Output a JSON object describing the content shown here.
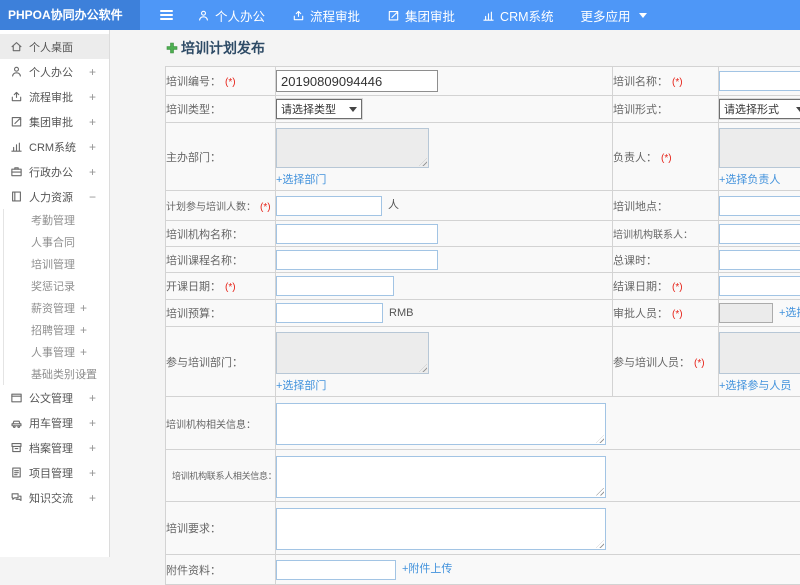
{
  "topbar": {
    "logo": "PHPOA协同办公软件",
    "menu_icon": "hamburger-icon",
    "nav": [
      {
        "label": "个人办公",
        "icon": "user-icon"
      },
      {
        "label": "流程审批",
        "icon": "flow-icon"
      },
      {
        "label": "集团审批",
        "icon": "edit-icon"
      },
      {
        "label": "CRM系统",
        "icon": "chart-icon"
      },
      {
        "label": "更多应用",
        "icon": "caret-down-icon",
        "dropdown": true
      }
    ]
  },
  "sidebar": {
    "items": [
      {
        "label": "个人桌面",
        "icon": "home-icon",
        "active": true
      },
      {
        "label": "个人办公",
        "icon": "user-icon",
        "expand": "+"
      },
      {
        "label": "流程审批",
        "icon": "flow-icon",
        "expand": "+"
      },
      {
        "label": "集团审批",
        "icon": "edit-icon",
        "expand": "+"
      },
      {
        "label": "CRM系统",
        "icon": "chart-icon",
        "expand": "+"
      },
      {
        "label": "行政办公",
        "icon": "briefcase-icon",
        "expand": "+"
      },
      {
        "label": "人力资源",
        "icon": "hr-icon",
        "expand": "−"
      },
      {
        "label": "考勤管理",
        "sub": true
      },
      {
        "label": "人事合同",
        "sub": true
      },
      {
        "label": "培训管理",
        "sub": true
      },
      {
        "label": "奖惩记录",
        "sub": true
      },
      {
        "label": "薪资管理",
        "sub": true,
        "expand": "+"
      },
      {
        "label": "招聘管理",
        "sub": true,
        "expand": "+"
      },
      {
        "label": "人事管理",
        "sub": true,
        "expand": "+"
      },
      {
        "label": "基础类别设置",
        "sub": true,
        "expand": "+"
      },
      {
        "label": "公文管理",
        "icon": "doc-icon",
        "expand": "+"
      },
      {
        "label": "用车管理",
        "icon": "car-icon",
        "expand": "+"
      },
      {
        "label": "档案管理",
        "icon": "archive-icon",
        "expand": "+"
      },
      {
        "label": "项目管理",
        "icon": "project-icon",
        "expand": "+"
      },
      {
        "label": "知识交流",
        "icon": "chat-icon",
        "expand": "+"
      }
    ]
  },
  "form": {
    "title": "培训计划发布",
    "title_icon": "plus-icon",
    "required_mark": "(*)",
    "pairs": [
      {
        "left": {
          "name": "training-number",
          "label": "培训编号：",
          "required": true,
          "value": "20190809094446"
        },
        "right": {
          "name": "training-name",
          "label": "培训名称：",
          "required": true
        }
      },
      {
        "left": {
          "name": "training-type",
          "label": "培训类型：",
          "value": "请选择类型"
        },
        "right": {
          "name": "training-form",
          "label": "培训形式：",
          "value": "请选择形式"
        }
      },
      {
        "left": {
          "name": "host-department",
          "label": "主办部门：",
          "link": "+选择部门"
        },
        "right": {
          "name": "person-in-charge",
          "label": "负责人：",
          "required": true,
          "link": "+选择负责人"
        }
      },
      {
        "left": {
          "name": "planned-participants",
          "label": "计划参与培训人数：",
          "required": true,
          "suffix": "人"
        },
        "right": {
          "name": "training-location",
          "label": "培训地点："
        }
      },
      {
        "left": {
          "name": "training-org-name",
          "label": "培训机构名称："
        },
        "right": {
          "name": "training-org-contact",
          "label": "培训机构联系人："
        }
      },
      {
        "left": {
          "name": "training-course-name",
          "label": "培训课程名称："
        },
        "right": {
          "name": "total-hours",
          "label": "总课时："
        }
      },
      {
        "left": {
          "name": "start-date",
          "label": "开课日期：",
          "required": true
        },
        "right": {
          "name": "end-date",
          "label": "结课日期：",
          "required": true
        }
      },
      {
        "left": {
          "name": "training-budget",
          "label": "培训预算：",
          "suffix": "RMB"
        },
        "right": {
          "name": "approvers",
          "label": "审批人员：",
          "required": true,
          "link": "+选择审批人员"
        }
      },
      {
        "left": {
          "name": "participating-departments",
          "label": "参与培训部门：",
          "link": "+选择部门"
        },
        "right": {
          "name": "participants",
          "label": "参与培训人员：",
          "required": true,
          "link": "+选择参与人员"
        }
      }
    ],
    "full_rows": [
      {
        "name": "training-org-info",
        "label": "培训机构相关信息："
      },
      {
        "name": "training-org-contact-info",
        "label": "培训机构联系人相关信息："
      },
      {
        "name": "training-requirements",
        "label": "培训要求："
      },
      {
        "name": "attachments",
        "label": "附件资料：",
        "link": "+附件上传"
      }
    ]
  }
}
